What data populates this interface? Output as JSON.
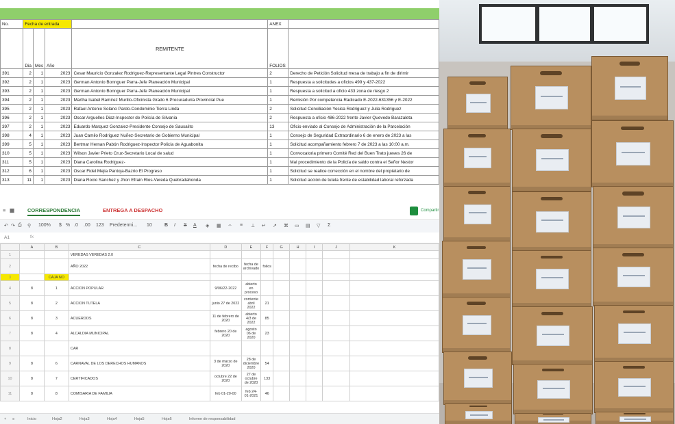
{
  "top_sheet": {
    "header": {
      "col_no": "No.",
      "col_fecha": "Fecha de entrada",
      "col_remitente": "REMITENTE",
      "col_anex": "ANEX",
      "col_dia": "Dia",
      "col_mes": "Mes",
      "col_ano": "Año",
      "col_folios": "FOLIOS"
    },
    "rows": [
      {
        "no": "391",
        "dia": "2",
        "mes": "1",
        "ano": "2023",
        "remitente": "Cesar Mauricio Gonzalez Rodriguez-Representante Legal Pintres Constructor",
        "folios": "2",
        "asunto": "Derecho de Petición Solicitud mesa de trabajo a fin de dirimir"
      },
      {
        "no": "392",
        "dia": "2",
        "mes": "1",
        "ano": "2023",
        "remitente": "German Antonio Bonnguer Parra-Jefe Planeación Municipal",
        "folios": "1",
        "asunto": "Respuesta a solicitudes a oficios 499 y 437-2022"
      },
      {
        "no": "393",
        "dia": "2",
        "mes": "1",
        "ano": "2023",
        "remitente": "German Antonio Bonnguer Parra-Jefe Planeación Municipal",
        "folios": "1",
        "asunto": "Respuesta a solicitud a oficio 433 zona de riesgo 2"
      },
      {
        "no": "394",
        "dia": "2",
        "mes": "1",
        "ano": "2023",
        "remitente": "Martha Isabel Ramirez Murillo-Oficinista Grado 6 Procuraduría Provincial Pue",
        "folios": "1",
        "asunto": "Remisión Por competencia Radicado E-2022-631356 y E-2022"
      },
      {
        "no": "395",
        "dia": "2",
        "mes": "1",
        "ano": "2023",
        "remitente": "Rafael Antonio Solano Pardo-Condominio Tierra Linda",
        "folios": "2",
        "asunto": "Solicitud Conciliación Yesica Rodriguez y Julia Rodriguez"
      },
      {
        "no": "396",
        "dia": "2",
        "mes": "1",
        "ano": "2023",
        "remitente": "Oscar Arguelles Diaz-Inspector de Policía de Silvania",
        "folios": "2",
        "asunto": "Respuesta a oficio 486-2022 frente Javier Quevedo Barazaleta"
      },
      {
        "no": "397",
        "dia": "2",
        "mes": "1",
        "ano": "2023",
        "remitente": "Eduardo Marquez Gonzalez-Presidente Consejo de Sausalito",
        "folios": "13",
        "asunto": "Oficio enviado al Consejo de Administración de la Parcelación"
      },
      {
        "no": "398",
        "dia": "4",
        "mes": "1",
        "ano": "2023",
        "remitente": "Juan Camilo Rodriguez Nuñez-Secretario de Gobierno Municipal",
        "folios": "1",
        "asunto": "Consejo de Seguridad Extraordinario 6 de enero de 2023 a las"
      },
      {
        "no": "399",
        "dia": "5",
        "mes": "1",
        "ano": "2023",
        "remitente": "Bertmar Hernan Pabón Rodriguez-Inspector Policía de Aguabonita",
        "folios": "1",
        "asunto": "Solicitud acompañamiento febrero 7 de 2023 a las 10:00 a.m."
      },
      {
        "no": "310",
        "dia": "5",
        "mes": "1",
        "ano": "2023",
        "remitente": "Wilson Javier Prieto Cruz-Secretario Local de salud",
        "folios": "1",
        "asunto": "Convocatoria primero Comité Red del Buen Trato jueves 26 de"
      },
      {
        "no": "311",
        "dia": "5",
        "mes": "1",
        "ano": "2023",
        "remitente": "Diana Carolina Rodriguez-",
        "folios": "1",
        "asunto": "Mal procedimiento de la Policía de saldo contra el Señor Nestor"
      },
      {
        "no": "312",
        "dia": "6",
        "mes": "1",
        "ano": "2023",
        "remitente": "Oscar Fidel Mejia Pantoja-Bazrio El Progreso",
        "folios": "1",
        "asunto": "Solicitud se realice corrección en el nombre del propietario de"
      },
      {
        "no": "313",
        "dia": "11",
        "mes": "1",
        "ano": "2023",
        "remitente": "Diana Rocio Sanchez y Jhon Efrain Rios-Vereda Quebradahonda",
        "folios": "1",
        "asunto": "Solicitud acción de tutela frente de estabilidad laboral reforzada"
      }
    ]
  },
  "bottom_sheet": {
    "tabs": [
      "CORRESPONDENCIA",
      "ENTREGA A DESPACHO"
    ],
    "share_label": "Compartir",
    "toolbar": [
      "100%",
      "$",
      "%",
      ".0",
      ".00",
      "123",
      "Predetermi...",
      "10",
      "B",
      "I",
      "S",
      "A"
    ],
    "cell_ref": "A1",
    "col_headers": [
      "",
      "A",
      "B",
      "C",
      "D",
      "E",
      "F",
      "G",
      "H",
      "I",
      "J",
      "K"
    ],
    "rows": [
      {
        "rh": "1",
        "a": "",
        "b": "",
        "c": "VEREDAS VEREDAS 2.0",
        "d": "",
        "e": "",
        "f": ""
      },
      {
        "rh": "2",
        "a": "",
        "b": "",
        "c": "AÑO 2022",
        "d": "fecha de recibo",
        "e": "fecha de archivado",
        "f": "folios"
      },
      {
        "rh": "3",
        "a": "",
        "b": "CAJA NO",
        "c": "",
        "d": "",
        "e": "",
        "f": ""
      },
      {
        "rh": "4",
        "a": "8",
        "b": "1",
        "c": "ACCION POPULAR",
        "d": "9/06/22-2022",
        "e": "abierto en proceso",
        "f": ""
      },
      {
        "rh": "5",
        "a": "8",
        "b": "2",
        "c": "ACCION TUTELA",
        "d": "junio 27 de 2022",
        "e": "corriente abril 2022",
        "f": "21"
      },
      {
        "rh": "6",
        "a": "8",
        "b": "3",
        "c": "ACUERDOS",
        "d": "11 de febrero de 2020",
        "e": "abierto 4/3 de 2022",
        "f": "85"
      },
      {
        "rh": "7",
        "a": "8",
        "b": "4",
        "c": "ALCALDIA MUNICIPAL",
        "d": "febrero 20 de 2020",
        "e": "agosto 06 de 2020",
        "f": "23"
      },
      {
        "rh": "8",
        "a": "",
        "b": "",
        "c": "CAR",
        "d": "",
        "e": "",
        "f": ""
      },
      {
        "rh": "9",
        "a": "8",
        "b": "6",
        "c": "CARNAVAL DE LOS DERECHOS HUMANOS",
        "d": "3 de marzo de 2020",
        "e": "28 de diciembre 2020",
        "f": "54"
      },
      {
        "rh": "10",
        "a": "8",
        "b": "7",
        "c": "CERTIFICADOS",
        "d": "octubre 22 de 2020",
        "e": "27 de octubre de 2020",
        "f": "133"
      },
      {
        "rh": "11",
        "a": "8",
        "b": "8",
        "c": "COMISARIA DE FAMILIA",
        "d": "feb 01-20-00",
        "e": "feb 24-01-2021",
        "f": "46"
      }
    ],
    "sheet_tabs": [
      "Inicio",
      "Hoja2",
      "Hoja3",
      "Hoja4",
      "Hoja5",
      "Hoja6",
      "Informe de responsabilidad"
    ]
  },
  "photo": {
    "subject": "stacked archive boxes"
  }
}
